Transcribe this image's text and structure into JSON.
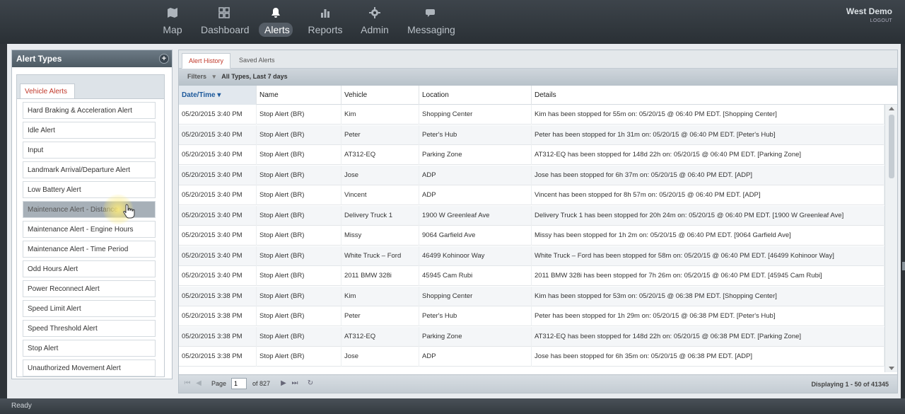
{
  "nav": {
    "items": [
      {
        "label": "Map",
        "icon": "map-icon"
      },
      {
        "label": "Dashboard",
        "icon": "dashboard-icon"
      },
      {
        "label": "Alerts",
        "icon": "bell-icon"
      },
      {
        "label": "Reports",
        "icon": "bar-chart-icon"
      },
      {
        "label": "Admin",
        "icon": "gear-icon"
      },
      {
        "label": "Messaging",
        "icon": "chat-icon"
      }
    ],
    "active": "Alerts"
  },
  "user": {
    "name": "West Demo",
    "logout": "LOGOUT"
  },
  "left_panel": {
    "title": "Alert Types",
    "tab": "Vehicle Alerts",
    "items": [
      "Hard Braking & Acceleration Alert",
      "Idle Alert",
      "Input",
      "Landmark Arrival/Departure Alert",
      "Low Battery Alert",
      "Maintenance Alert - Distance",
      "Maintenance Alert - Engine Hours",
      "Maintenance Alert - Time Period",
      "Odd Hours Alert",
      "Power Reconnect Alert",
      "Speed Limit Alert",
      "Speed Threshold Alert",
      "Stop Alert",
      "Unauthorized Movement Alert"
    ],
    "selected_index": 5
  },
  "right_panel": {
    "tabs": [
      "Alert History",
      "Saved Alerts"
    ],
    "filters_label": "Filters",
    "filters_value": "All Types, Last 7 days",
    "columns": [
      "Date/Time",
      "Name",
      "Vehicle",
      "Location",
      "Details"
    ],
    "rows": [
      [
        "05/20/2015 3:40 PM",
        "Stop Alert (BR)",
        "Kim",
        "Shopping Center",
        "Kim has been stopped for 55m on: 05/20/15 @ 06:40 PM EDT. [Shopping Center]"
      ],
      [
        "05/20/2015 3:40 PM",
        "Stop Alert (BR)",
        "Peter",
        "Peter's Hub",
        "Peter has been stopped for 1h 31m on: 05/20/15 @ 06:40 PM EDT. [Peter's Hub]"
      ],
      [
        "05/20/2015 3:40 PM",
        "Stop Alert (BR)",
        "AT312-EQ",
        "Parking Zone",
        "AT312-EQ has been stopped for 148d 22h on: 05/20/15 @ 06:40 PM EDT. [Parking Zone]"
      ],
      [
        "05/20/2015 3:40 PM",
        "Stop Alert (BR)",
        "Jose",
        "ADP",
        "Jose has been stopped for 6h 37m on: 05/20/15 @ 06:40 PM EDT. [ADP]"
      ],
      [
        "05/20/2015 3:40 PM",
        "Stop Alert (BR)",
        "Vincent",
        "ADP",
        "Vincent has been stopped for 8h 57m on: 05/20/15 @ 06:40 PM EDT. [ADP]"
      ],
      [
        "05/20/2015 3:40 PM",
        "Stop Alert (BR)",
        "Delivery Truck 1",
        "1900 W Greenleaf Ave",
        "Delivery Truck 1 has been stopped for 20h 24m on: 05/20/15 @ 06:40 PM EDT. [1900 W Greenleaf Ave]"
      ],
      [
        "05/20/2015 3:40 PM",
        "Stop Alert (BR)",
        "Missy",
        "9064 Garfield Ave",
        "Missy has been stopped for 1h 2m on: 05/20/15 @ 06:40 PM EDT. [9064 Garfield Ave]"
      ],
      [
        "05/20/2015 3:40 PM",
        "Stop Alert (BR)",
        "White Truck – Ford",
        "46499 Kohinoor Way",
        "White Truck – Ford has been stopped for 58m on: 05/20/15 @ 06:40 PM EDT. [46499 Kohinoor Way]"
      ],
      [
        "05/20/2015 3:40 PM",
        "Stop Alert (BR)",
        "2011 BMW 328i",
        "45945 Cam Rubi",
        "2011 BMW 328i has been stopped for 7h 26m on: 05/20/15 @ 06:40 PM EDT. [45945 Cam Rubi]"
      ],
      [
        "05/20/2015 3:38 PM",
        "Stop Alert (BR)",
        "Kim",
        "Shopping Center",
        "Kim has been stopped for 53m on: 05/20/15 @ 06:38 PM EDT. [Shopping Center]"
      ],
      [
        "05/20/2015 3:38 PM",
        "Stop Alert (BR)",
        "Peter",
        "Peter's Hub",
        "Peter has been stopped for 1h 29m on: 05/20/15 @ 06:38 PM EDT. [Peter's Hub]"
      ],
      [
        "05/20/2015 3:38 PM",
        "Stop Alert (BR)",
        "AT312-EQ",
        "Parking Zone",
        "AT312-EQ has been stopped for 148d 22h on: 05/20/15 @ 06:38 PM EDT. [Parking Zone]"
      ],
      [
        "05/20/2015 3:38 PM",
        "Stop Alert (BR)",
        "Jose",
        "ADP",
        "Jose has been stopped for 6h 35m on: 05/20/15 @ 06:38 PM EDT. [ADP]"
      ]
    ],
    "pager": {
      "page_label": "Page",
      "page": "1",
      "of_label": "of 827",
      "display": "Displaying 1 - 50 of 41345"
    }
  },
  "status": "Ready",
  "colors": {
    "accent": "#c0392b",
    "sort_link": "#1e5a9c",
    "header_bg": "#2e3338"
  }
}
